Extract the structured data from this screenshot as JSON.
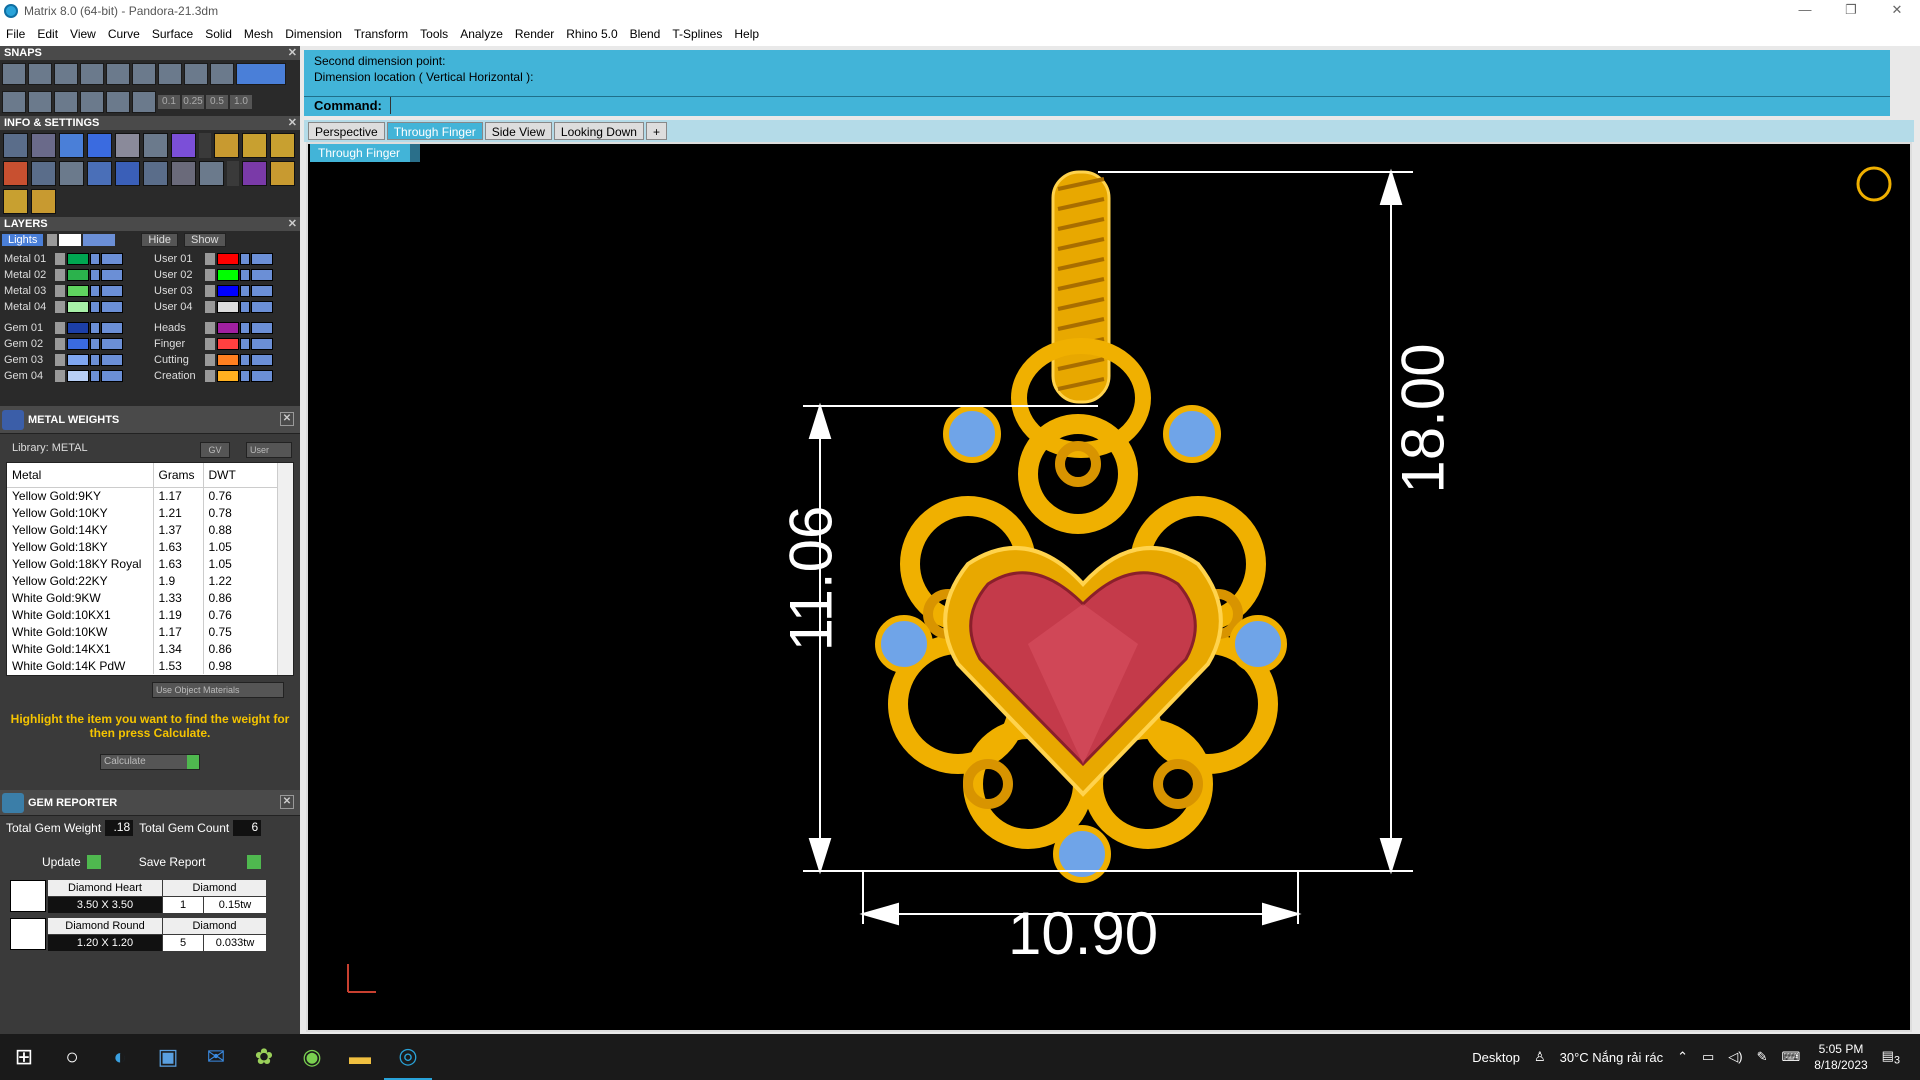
{
  "window": {
    "title": "Matrix 8.0 (64-bit) - Pandora-21.3dm",
    "minimize": "—",
    "restore": "❐",
    "close": "✕"
  },
  "menu": [
    "File",
    "Edit",
    "View",
    "Curve",
    "Surface",
    "Solid",
    "Mesh",
    "Dimension",
    "Transform",
    "Tools",
    "Analyze",
    "Render",
    "Rhino 5.0",
    "Blend",
    "T-Splines",
    "Help"
  ],
  "panels": {
    "snaps": "SNAPS",
    "info_settings": "INFO & SETTINGS",
    "layers": "LAYERS"
  },
  "snap_values": [
    "0.1",
    "0.25",
    "0.5",
    "1.0"
  ],
  "layers": {
    "lights_label": "Lights",
    "hide_label": "Hide",
    "show_label": "Show",
    "left": [
      {
        "name": "Metal 01",
        "color": "#00a651"
      },
      {
        "name": "Metal 02",
        "color": "#2bb24c"
      },
      {
        "name": "Metal 03",
        "color": "#5fd35f"
      },
      {
        "name": "Metal 04",
        "color": "#a8f0a8"
      },
      {
        "name": "Gem 01",
        "color": "#1c3fa8"
      },
      {
        "name": "Gem 02",
        "color": "#3a6be0"
      },
      {
        "name": "Gem 03",
        "color": "#7fa6f0"
      },
      {
        "name": "Gem 04",
        "color": "#b8cff5"
      }
    ],
    "right": [
      {
        "name": "User 01",
        "color": "#ff0000"
      },
      {
        "name": "User 02",
        "color": "#00ff00"
      },
      {
        "name": "User 03",
        "color": "#0000ff"
      },
      {
        "name": "User 04",
        "color": "#dddddd"
      },
      {
        "name": "Heads",
        "color": "#a020a0"
      },
      {
        "name": "Finger",
        "color": "#ff4040"
      },
      {
        "name": "Cutting",
        "color": "#ff8020"
      },
      {
        "name": "Creation",
        "color": "#ffb020"
      }
    ]
  },
  "metal_weights": {
    "title": "METAL WEIGHTS",
    "library": "Library: METAL",
    "gv": "GV",
    "user": "User",
    "headers": [
      "Metal",
      "Grams",
      "DWT"
    ],
    "rows": [
      [
        "Yellow Gold:9KY",
        "1.17",
        "0.76"
      ],
      [
        "Yellow Gold:10KY",
        "1.21",
        "0.78"
      ],
      [
        "Yellow Gold:14KY",
        "1.37",
        "0.88"
      ],
      [
        "Yellow Gold:18KY",
        "1.63",
        "1.05"
      ],
      [
        "Yellow Gold:18KY Royal",
        "1.63",
        "1.05"
      ],
      [
        "Yellow Gold:22KY",
        "1.9",
        "1.22"
      ],
      [
        "White Gold:9KW",
        "1.33",
        "0.86"
      ],
      [
        "White Gold:10KX1",
        "1.19",
        "0.76"
      ],
      [
        "White Gold:10KW",
        "1.17",
        "0.75"
      ],
      [
        "White Gold:14KX1",
        "1.34",
        "0.86"
      ],
      [
        "White Gold:14K PdW",
        "1.53",
        "0.98"
      ]
    ],
    "use_object_materials": "Use Object Materials",
    "hint": "Highlight the item you want to find the weight for then press Calculate.",
    "calculate": "Calculate"
  },
  "gem_reporter": {
    "title": "GEM REPORTER",
    "total_weight_label": "Total Gem Weight",
    "total_weight": ".18",
    "total_count_label": "Total Gem Count",
    "total_count": "6",
    "update": "Update",
    "save_report": "Save Report",
    "gems": [
      {
        "shape": "Diamond Heart",
        "type": "Diamond",
        "size": "3.50 X 3.50",
        "count": "1",
        "weight": "0.15tw"
      },
      {
        "shape": "Diamond Round",
        "type": "Diamond",
        "size": "1.20 X 1.20",
        "count": "5",
        "weight": "0.033tw"
      }
    ]
  },
  "command": {
    "line1": "Second dimension point:",
    "line2": "Dimension location ( Vertical  Horizontal ):",
    "label": "Command:"
  },
  "tabs": [
    "Perspective",
    "Through Finger",
    "Side View",
    "Looking Down",
    "+"
  ],
  "active_tab": "Through Finger",
  "viewport_label": "Through Finger",
  "dimensions": {
    "height_body": "11.06",
    "height_total": "18.00",
    "width": "10.90"
  },
  "taskbar": {
    "desktop": "Desktop",
    "weather": "30°C  Nắng rải rác",
    "time": "5:05 PM",
    "date": "8/18/2023",
    "notif": "3"
  },
  "colors": {
    "accent": "#42b4d8",
    "gold": "#f5b800",
    "ruby": "#c43a4a",
    "gem": "#6fa4e8"
  }
}
